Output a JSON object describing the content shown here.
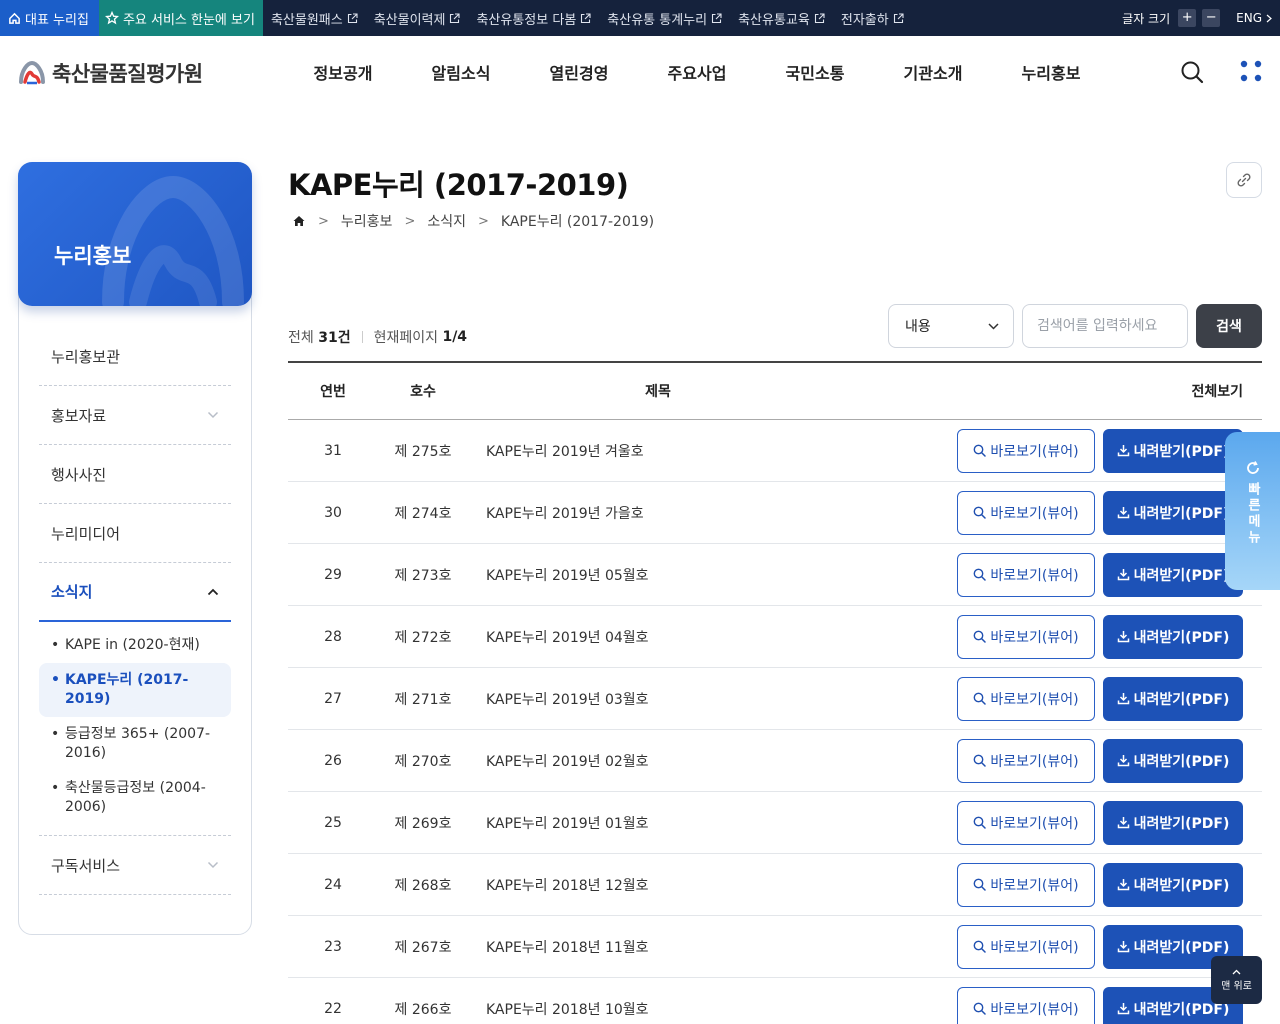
{
  "topbar": {
    "home": "대표 누리집",
    "main_services": "주요 서비스 한눈에 보기",
    "links": [
      "축산물원패스",
      "축산물이력제",
      "축산유통정보 다봄",
      "축산유통 통계누리",
      "축산유통교육",
      "전자출하"
    ],
    "font_size_label": "글자 크기",
    "font_plus": "+",
    "font_minus": "−",
    "lang": "ENG"
  },
  "header": {
    "logo_text": "축산물품질평가원",
    "nav": [
      "정보공개",
      "알림소식",
      "열린경영",
      "주요사업",
      "국민소통",
      "기관소개",
      "누리홍보"
    ]
  },
  "lnb": {
    "title": "누리홍보",
    "items": [
      {
        "label": "누리홍보관"
      },
      {
        "label": "홍보자료"
      },
      {
        "label": "행사사진"
      },
      {
        "label": "누리미디어"
      },
      {
        "label": "소식지"
      },
      {
        "label": "구독서비스"
      }
    ],
    "sub_items": [
      {
        "label": "KAPE in (2020-현재)"
      },
      {
        "label": "KAPE누리 (2017-2019)"
      },
      {
        "label": "등급정보 365+ (2007-2016)"
      },
      {
        "label": "축산물등급정보 (2004-2006)"
      }
    ]
  },
  "content": {
    "title": "KAPE누리 (2017-2019)",
    "breadcrumb": [
      "누리홍보",
      "소식지",
      "KAPE누리 (2017-2019)"
    ],
    "total_label": "전체",
    "total_count": "31건",
    "page_label": "현재페이지",
    "page_value": "1/4",
    "search": {
      "select_value": "내용",
      "placeholder": "검색어를 입력하세요",
      "button": "검색"
    },
    "table": {
      "headers": [
        "연번",
        "호수",
        "제목",
        "전체보기"
      ],
      "view_label": "바로보기(뷰어)",
      "pdf_label": "내려받기(PDF)",
      "rows": [
        {
          "no": "31",
          "issue": "제 275호",
          "title": "KAPE누리 2019년 겨울호"
        },
        {
          "no": "30",
          "issue": "제 274호",
          "title": "KAPE누리 2019년 가을호"
        },
        {
          "no": "29",
          "issue": "제 273호",
          "title": "KAPE누리 2019년 05월호"
        },
        {
          "no": "28",
          "issue": "제 272호",
          "title": "KAPE누리 2019년 04월호"
        },
        {
          "no": "27",
          "issue": "제 271호",
          "title": "KAPE누리 2019년 03월호"
        },
        {
          "no": "26",
          "issue": "제 270호",
          "title": "KAPE누리 2019년 02월호"
        },
        {
          "no": "25",
          "issue": "제 269호",
          "title": "KAPE누리 2019년 01월호"
        },
        {
          "no": "24",
          "issue": "제 268호",
          "title": "KAPE누리 2018년 12월호"
        },
        {
          "no": "23",
          "issue": "제 267호",
          "title": "KAPE누리 2018년 11월호"
        },
        {
          "no": "22",
          "issue": "제 266호",
          "title": "KAPE누리 2018년 10월호"
        }
      ]
    }
  },
  "quick_menu": {
    "label": "빠른메뉴"
  },
  "to_top": {
    "label": "맨 위로"
  },
  "colors": {
    "primary": "#1d52b7",
    "topbar": "#15223c",
    "home_bg": "#1b5ec9",
    "services_bg": "#15857d"
  }
}
